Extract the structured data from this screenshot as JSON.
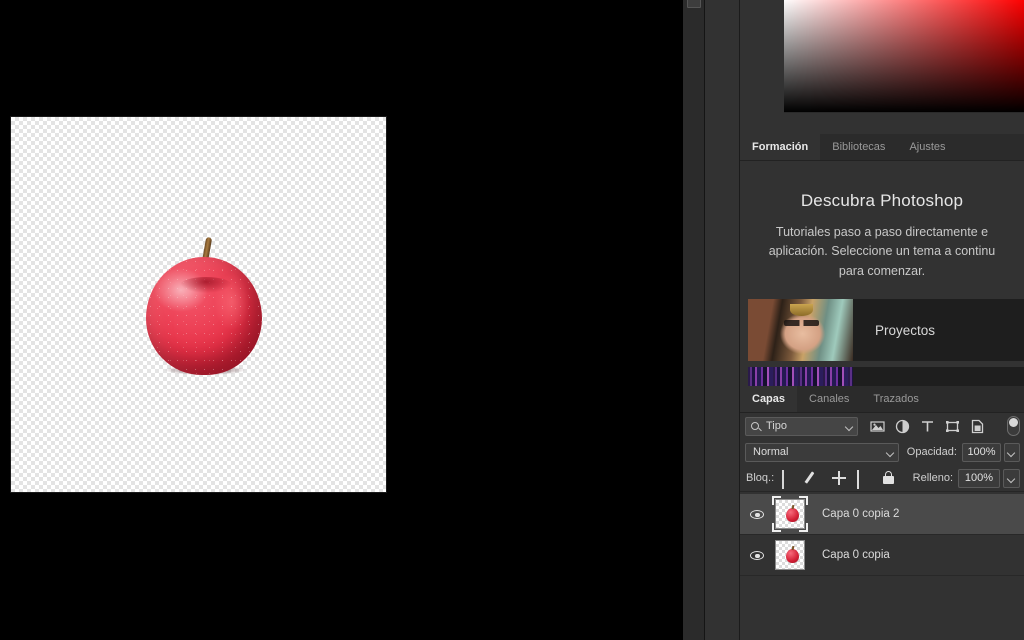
{
  "workspace": {
    "canvas_name": "document-canvas",
    "artwork_label": "red-apple"
  },
  "color_panel": {
    "name": "color-picker",
    "hue": "#ff0000"
  },
  "discover_panel": {
    "tabs": [
      {
        "label": "Formación",
        "active": true
      },
      {
        "label": "Bibliotecas",
        "active": false
      },
      {
        "label": "Ajustes",
        "active": false
      }
    ],
    "title": "Descubra Photoshop",
    "description_lines": [
      "Tutoriales paso a paso directamente e",
      "aplicación. Seleccione un tema a continu",
      "para comenzar."
    ],
    "cards": [
      {
        "label": "Proyectos",
        "thumb": "portrait-thumbnail"
      },
      {
        "label": "",
        "thumb": "gradient-strip-thumbnail"
      }
    ]
  },
  "layers_panel": {
    "tabs": [
      {
        "label": "Capas",
        "active": true
      },
      {
        "label": "Canales",
        "active": false
      },
      {
        "label": "Trazados",
        "active": false
      }
    ],
    "filter": {
      "value": "Tipo",
      "icons": [
        "pixel-layer-filter-icon",
        "adjustment-layer-filter-icon",
        "type-layer-filter-icon",
        "shape-layer-filter-icon",
        "smart-object-filter-icon"
      ],
      "toggle_name": "filter-enable-toggle"
    },
    "blend_mode": "Normal",
    "opacity_label": "Opacidad:",
    "opacity_value": "100%",
    "lock_label": "Bloq.:",
    "lock_icons": [
      "lock-transparent-pixels-icon",
      "lock-image-pixels-icon",
      "lock-position-icon",
      "lock-artboard-nesting-icon",
      "lock-all-icon"
    ],
    "fill_label": "Relleno:",
    "fill_value": "100%",
    "layers": [
      {
        "name": "Capa 0 copia 2",
        "visible": true,
        "selected": true
      },
      {
        "name": "Capa 0 copia",
        "visible": true,
        "selected": false
      }
    ]
  },
  "colors": {
    "panel_bg": "#323232",
    "panel_dark": "#2b2b2b",
    "selected_row": "#4a4a4a",
    "text": "#dcdcdc",
    "accent_red": "#ff0000"
  }
}
